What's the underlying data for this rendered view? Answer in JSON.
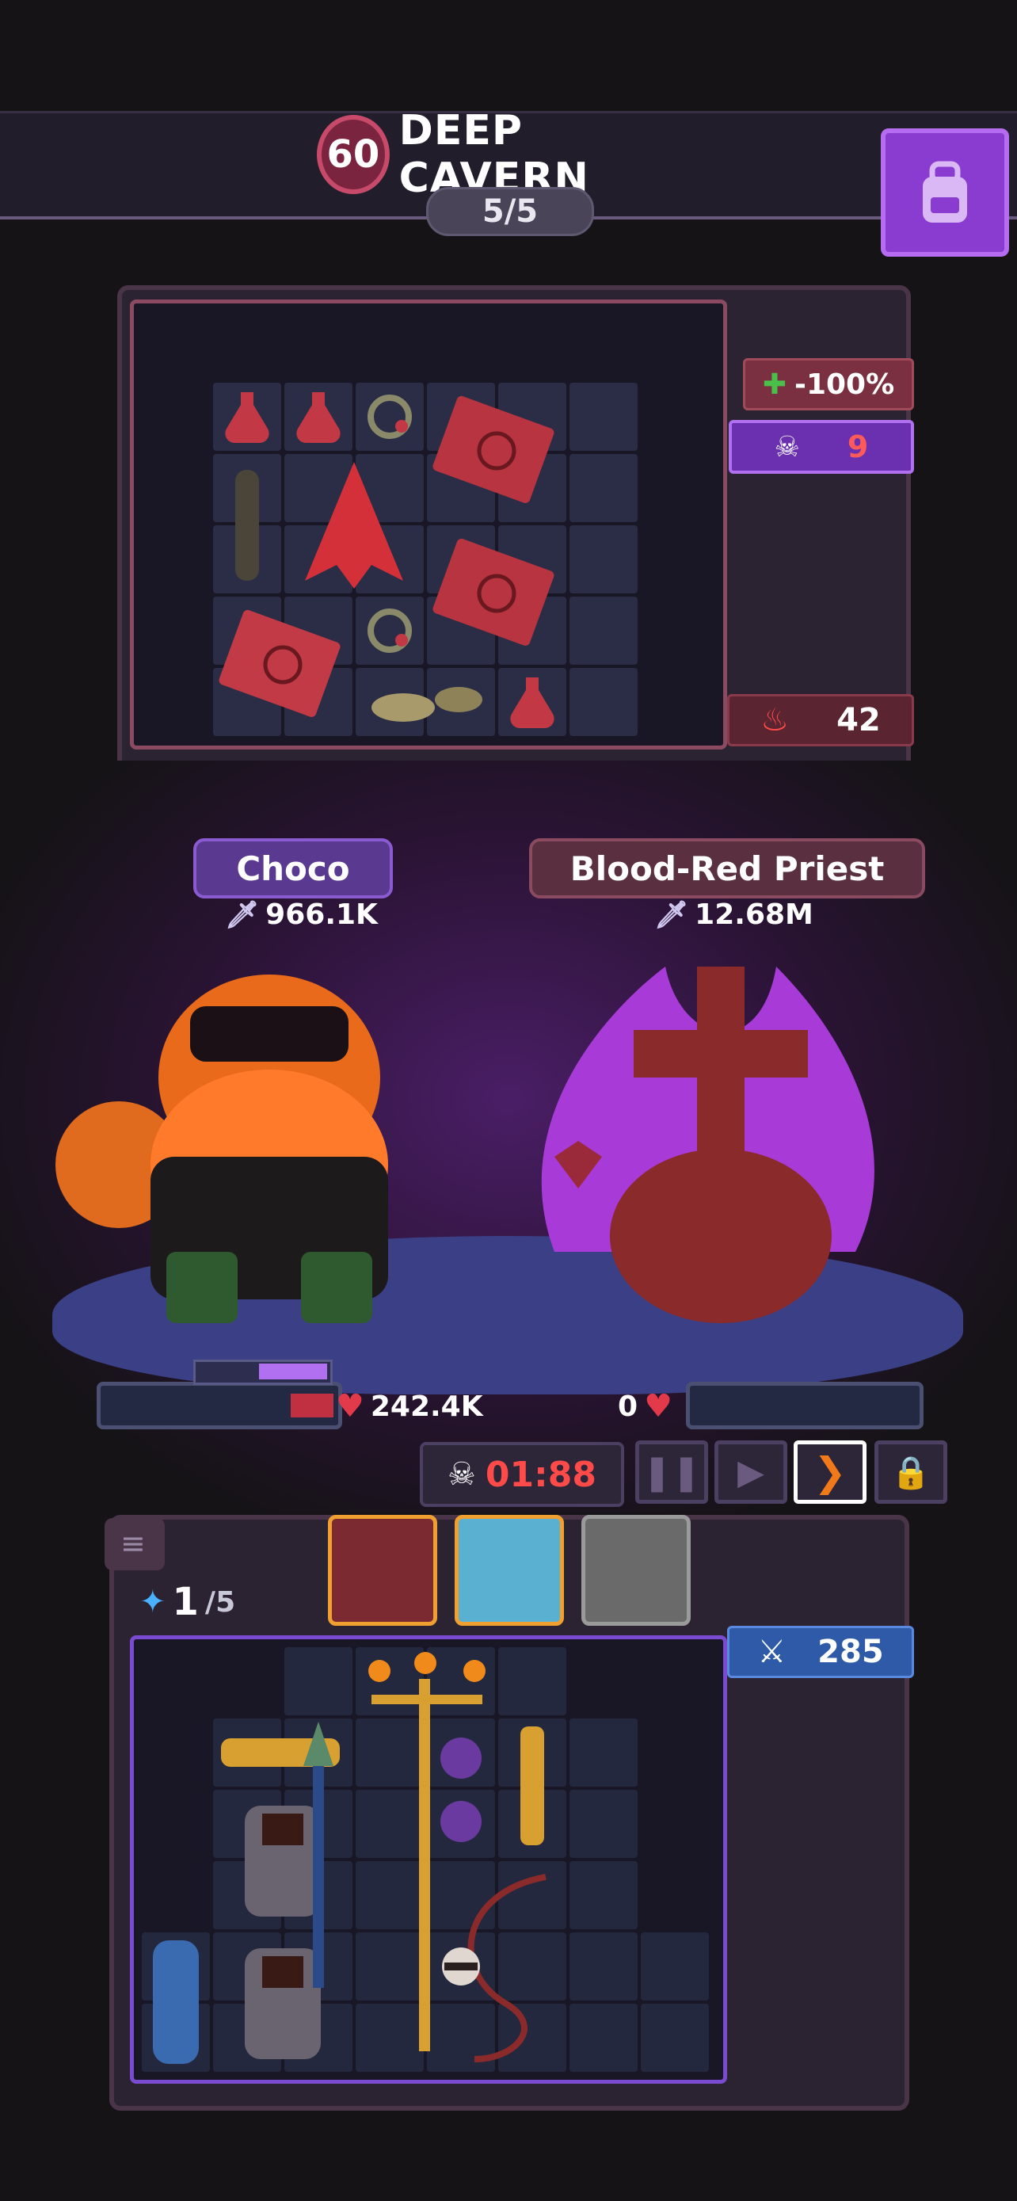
{
  "header": {
    "level": "60",
    "stage_name": "DEEP CAVERN",
    "wave": "5/5"
  },
  "enemy_effects": {
    "heal_reduction": "-100%",
    "skull_stack": "9",
    "rage": "42"
  },
  "player": {
    "name": "Choco",
    "power": "966.1K",
    "hp": "242.4K"
  },
  "enemy": {
    "name": "Blood-Red Priest",
    "power": "12.68M",
    "hp": "0"
  },
  "battle": {
    "timer": "01:88",
    "speed_controls": [
      "pause",
      "play",
      "fast-forward",
      "locked"
    ]
  },
  "inventory": {
    "gems": "1",
    "gems_max": "/5",
    "attack_count": "285"
  },
  "icons": [
    "backpack-icon",
    "skull-icon",
    "sword-icon",
    "heart-icon",
    "gem-icon",
    "crossed-swords-icon",
    "lock-icon"
  ],
  "colors": {
    "accent_purple": "#8a3bd0",
    "hp_red": "#e23a4a",
    "timer_red": "#ff4a4a",
    "rage_red": "#d83a3a"
  }
}
